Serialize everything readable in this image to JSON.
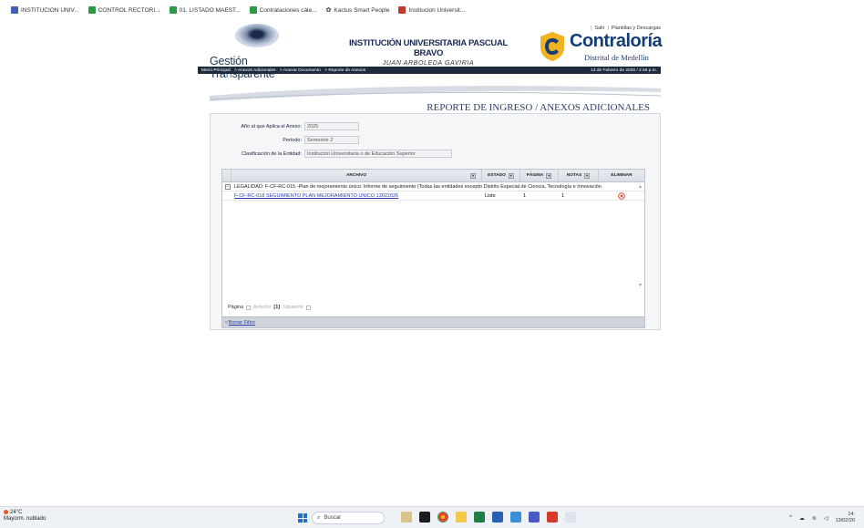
{
  "bookmarks": [
    {
      "label": "INSTITUCION UNIV...",
      "color": "#3f5fb0"
    },
    {
      "label": "CONTROL RECTORI...",
      "color": "#2b9a46"
    },
    {
      "label": "01. LISTADO MAEST...",
      "color": "#2b9a46"
    },
    {
      "label": "Contrataciones cále...",
      "color": "#2b9a46"
    },
    {
      "label": "Kactus Smart People",
      "color": "#333333"
    },
    {
      "label": "Institucion Universit...",
      "color": "#c0392b"
    }
  ],
  "header": {
    "salir": "Salir",
    "plantillas": "Plantillas y Descargas",
    "brand_left": "Gestión Tra",
    "brand_mid": "n",
    "brand_right": "sparente",
    "institution": "INSTITUCIÓN UNIVERSITARIA PASCUAL BRAVO",
    "institution_sub": "JUAN ARBOLEDA GAVIRIA",
    "contraloria": "Contraloría",
    "contraloria_sub": "Distrital de Medellín"
  },
  "navbar": {
    "crumbs": [
      "Menú Principal",
      "> Anexos Adicionales",
      "> Anexar Documento",
      "> Reporte de Anexos"
    ],
    "date": "13 de Febrero de 2026 / 2:46 p.m."
  },
  "report_title": "REPORTE DE INGRESO / ANEXOS ADICIONALES",
  "form": {
    "anio_label": "Año al que Aplica el Anexo:",
    "anio_value": "2025",
    "periodo_label": "Período:",
    "periodo_value": "Semestre 2",
    "clasif_label": "Clasificación de la Entidad:",
    "clasif_value": "Institución Universitaria o de Educación Superior"
  },
  "grid": {
    "columns": {
      "archivo": "ARCHIVO",
      "estado": "ESTADO",
      "pagina": "PÁGINA",
      "notas": "NOTAS",
      "eliminar": "ELIMINAR"
    },
    "group_toggle": "⊟",
    "group_label": "LEGALIDAD: F-CF-RC-015 -Plan de mejoramiento único: Informe de seguimiento (Todas las entidades excepto Distrito Especial de Ciencia, Tecnología e Innovación",
    "rows": [
      {
        "archivo": "F-CF-RC-018 SEGUIMIENTO PLAN MEJORAMIENTO UNICO 13022026",
        "estado": "Listo",
        "pagina": "1",
        "notas": "1"
      }
    ],
    "pager": {
      "label": "Página",
      "prev": "Anterior",
      "current": "[1]",
      "next": "Siguiente"
    },
    "clear_filter": "Borrar Filtro"
  },
  "taskbar": {
    "temp": "24°C",
    "weather": "Mayorm. nublado",
    "search": "Buscar",
    "time": "14:",
    "date": "13/02/20"
  }
}
